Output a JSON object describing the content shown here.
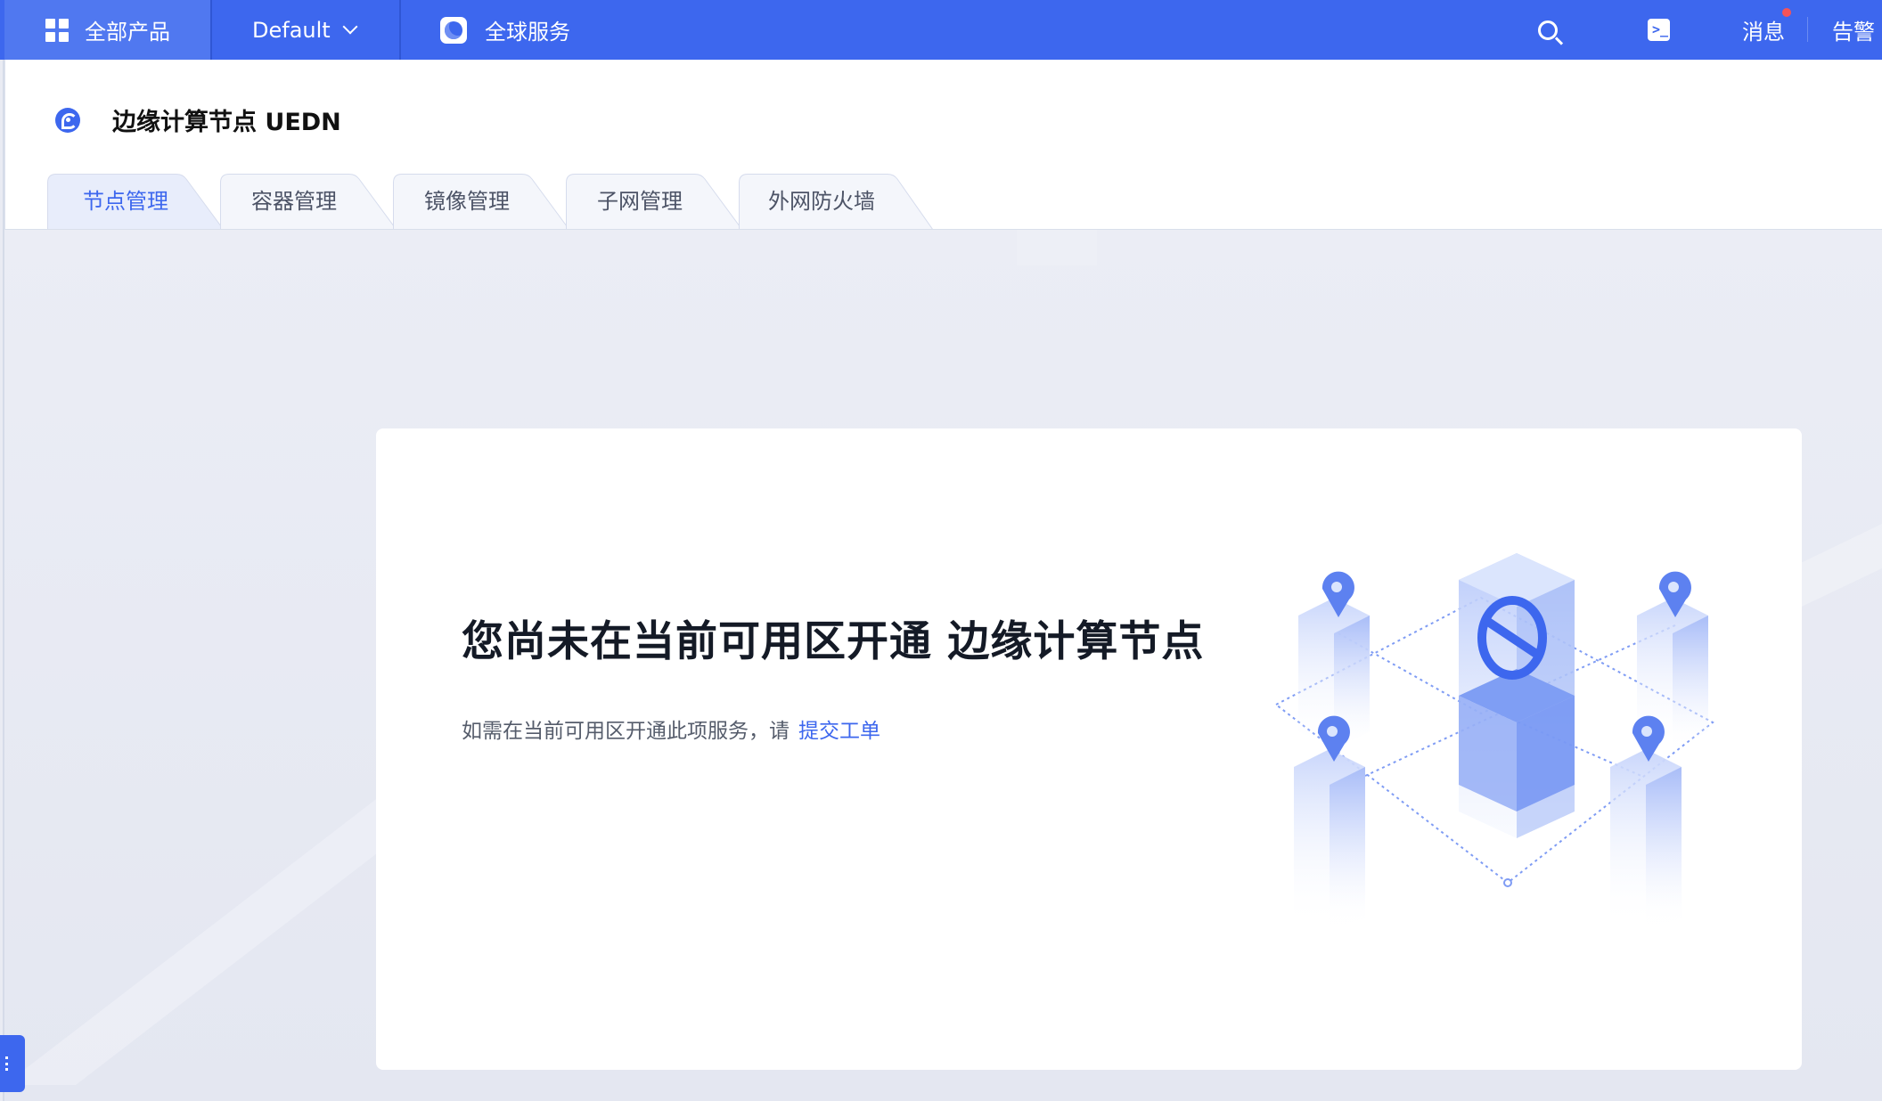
{
  "topbar": {
    "products_label": "全部产品",
    "project_label": "Default",
    "global_label": "全球服务",
    "messages_label": "消息",
    "alerts_label": "告警",
    "icons": [
      "grid-icon",
      "chevron-down-icon",
      "globe-icon",
      "search-icon",
      "terminal-icon",
      "notification-dot"
    ]
  },
  "header": {
    "title": "边缘计算节点 UEDN"
  },
  "tabs": [
    {
      "label": "节点管理",
      "active": true
    },
    {
      "label": "容器管理",
      "active": false
    },
    {
      "label": "镜像管理",
      "active": false
    },
    {
      "label": "子网管理",
      "active": false
    },
    {
      "label": "外网防火墙",
      "active": false
    }
  ],
  "empty_state": {
    "title": "您尚未在当前可用区开通 边缘计算节点",
    "description": "如需在当前可用区开通此项服务，请",
    "link": "提交工单"
  },
  "colors": {
    "brand": "#3d67ee",
    "background": "#e9ebf3",
    "notification": "#f55358"
  }
}
